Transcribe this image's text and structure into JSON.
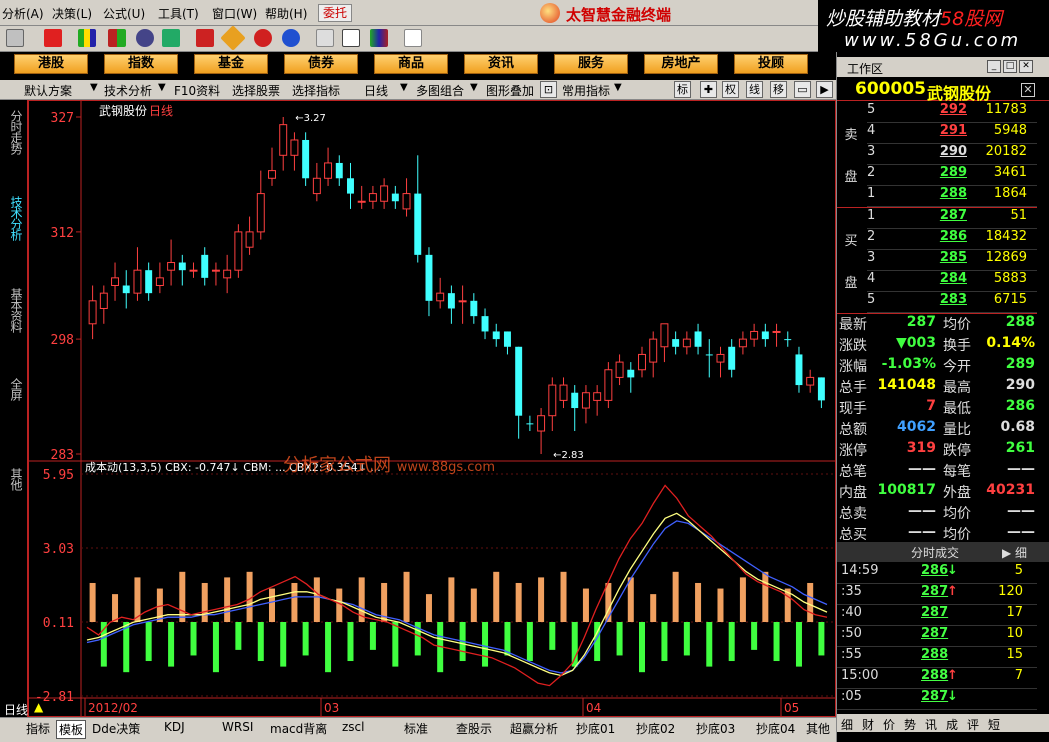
{
  "menu": [
    "分析(A)",
    "决策(L)",
    "公式(U)",
    "工具(T)",
    "窗口(W)",
    "帮助(H)"
  ],
  "weituo": "委托",
  "brand": "太智慧金融终端",
  "watermark": {
    "line1a": "炒股辅助教材",
    "line1b": "58股网",
    "line2": "www.58Gu.com"
  },
  "categories": [
    "港股",
    "指数",
    "基金",
    "债券",
    "商品",
    "资讯",
    "服务",
    "房地产",
    "投顾"
  ],
  "functions": [
    "默认方案",
    "技术分析",
    "F10资料",
    "选择股票",
    "选择指标",
    "日线",
    "多图组合",
    "图形叠加",
    "常用指标",
    "标",
    "权",
    "线",
    "移"
  ],
  "sidetabs": [
    "分时走势",
    "技术分析",
    "基本资料",
    "全屏",
    "其他"
  ],
  "chart": {
    "stock_name": "武钢股份",
    "period": "日线",
    "price_ticks": [
      "327",
      "312",
      "298",
      "283"
    ],
    "ind_ticks": [
      "5.95",
      "3.03",
      "0.11",
      "-2.81"
    ],
    "date_labels": [
      "2012/02",
      "03",
      "04",
      "05"
    ],
    "max_label": "3.27",
    "min_label": "2.83",
    "indicator_legend": "成本动(13,3,5)  CBX: -0.747↓  CBM: ...  CBX2: 0.354↓  ...",
    "watermark_text": "分析家公式网",
    "watermark_url": "www.88gs.com"
  },
  "chart_data": {
    "type": "candlestick",
    "title": "武钢股份 日线",
    "ylim": [
      2.83,
      3.27
    ],
    "candles": [
      {
        "o": 3.0,
        "c": 3.03,
        "h": 3.05,
        "l": 2.98,
        "up": true
      },
      {
        "o": 3.02,
        "c": 3.04,
        "h": 3.05,
        "l": 3.0,
        "up": true
      },
      {
        "o": 3.05,
        "c": 3.06,
        "h": 3.08,
        "l": 3.03,
        "up": true
      },
      {
        "o": 3.05,
        "c": 3.04,
        "h": 3.07,
        "l": 3.02,
        "up": false
      },
      {
        "o": 3.04,
        "c": 3.07,
        "h": 3.1,
        "l": 3.03,
        "up": true
      },
      {
        "o": 3.07,
        "c": 3.04,
        "h": 3.08,
        "l": 3.03,
        "up": false
      },
      {
        "o": 3.05,
        "c": 3.06,
        "h": 3.08,
        "l": 3.04,
        "up": true
      },
      {
        "o": 3.07,
        "c": 3.08,
        "h": 3.11,
        "l": 3.05,
        "up": true
      },
      {
        "o": 3.08,
        "c": 3.07,
        "h": 3.09,
        "l": 3.05,
        "up": false
      },
      {
        "o": 3.07,
        "c": 3.07,
        "h": 3.08,
        "l": 3.06,
        "up": true
      },
      {
        "o": 3.09,
        "c": 3.06,
        "h": 3.1,
        "l": 3.05,
        "up": false
      },
      {
        "o": 3.07,
        "c": 3.07,
        "h": 3.08,
        "l": 3.05,
        "up": true
      },
      {
        "o": 3.06,
        "c": 3.07,
        "h": 3.09,
        "l": 3.04,
        "up": true
      },
      {
        "o": 3.07,
        "c": 3.12,
        "h": 3.13,
        "l": 3.06,
        "up": true
      },
      {
        "o": 3.1,
        "c": 3.12,
        "h": 3.14,
        "l": 3.09,
        "up": true
      },
      {
        "o": 3.12,
        "c": 3.17,
        "h": 3.2,
        "l": 3.11,
        "up": true
      },
      {
        "o": 3.19,
        "c": 3.2,
        "h": 3.23,
        "l": 3.18,
        "up": true
      },
      {
        "o": 3.22,
        "c": 3.26,
        "h": 3.27,
        "l": 3.2,
        "up": true
      },
      {
        "o": 3.22,
        "c": 3.24,
        "h": 3.25,
        "l": 3.2,
        "up": true
      },
      {
        "o": 3.24,
        "c": 3.19,
        "h": 3.25,
        "l": 3.18,
        "up": false
      },
      {
        "o": 3.17,
        "c": 3.19,
        "h": 3.21,
        "l": 3.16,
        "up": true
      },
      {
        "o": 3.19,
        "c": 3.21,
        "h": 3.23,
        "l": 3.18,
        "up": true
      },
      {
        "o": 3.21,
        "c": 3.19,
        "h": 3.22,
        "l": 3.18,
        "up": false
      },
      {
        "o": 3.19,
        "c": 3.17,
        "h": 3.21,
        "l": 3.15,
        "up": false
      },
      {
        "o": 3.16,
        "c": 3.16,
        "h": 3.18,
        "l": 3.15,
        "up": true
      },
      {
        "o": 3.16,
        "c": 3.17,
        "h": 3.18,
        "l": 3.15,
        "up": true
      },
      {
        "o": 3.16,
        "c": 3.18,
        "h": 3.19,
        "l": 3.15,
        "up": true
      },
      {
        "o": 3.17,
        "c": 3.16,
        "h": 3.18,
        "l": 3.15,
        "up": false
      },
      {
        "o": 3.15,
        "c": 3.17,
        "h": 3.19,
        "l": 3.14,
        "up": true
      },
      {
        "o": 3.17,
        "c": 3.09,
        "h": 3.22,
        "l": 3.08,
        "up": false
      },
      {
        "o": 3.09,
        "c": 3.03,
        "h": 3.1,
        "l": 3.01,
        "up": false
      },
      {
        "o": 3.03,
        "c": 3.04,
        "h": 3.06,
        "l": 3.02,
        "up": true
      },
      {
        "o": 3.04,
        "c": 3.02,
        "h": 3.05,
        "l": 3.0,
        "up": false
      },
      {
        "o": 3.03,
        "c": 3.03,
        "h": 3.05,
        "l": 3.0,
        "up": true
      },
      {
        "o": 3.03,
        "c": 3.01,
        "h": 3.04,
        "l": 3.0,
        "up": false
      },
      {
        "o": 3.01,
        "c": 2.99,
        "h": 3.02,
        "l": 2.98,
        "up": false
      },
      {
        "o": 2.99,
        "c": 2.98,
        "h": 3.0,
        "l": 2.97,
        "up": false
      },
      {
        "o": 2.99,
        "c": 2.97,
        "h": 2.99,
        "l": 2.96,
        "up": false
      },
      {
        "o": 2.97,
        "c": 2.88,
        "h": 2.97,
        "l": 2.85,
        "up": false
      },
      {
        "o": 2.87,
        "c": 2.87,
        "h": 2.88,
        "l": 2.86,
        "up": false
      },
      {
        "o": 2.86,
        "c": 2.88,
        "h": 2.89,
        "l": 2.83,
        "up": true
      },
      {
        "o": 2.88,
        "c": 2.92,
        "h": 2.93,
        "l": 2.86,
        "up": true
      },
      {
        "o": 2.9,
        "c": 2.92,
        "h": 2.93,
        "l": 2.89,
        "up": true
      },
      {
        "o": 2.91,
        "c": 2.89,
        "h": 2.92,
        "l": 2.86,
        "up": false
      },
      {
        "o": 2.89,
        "c": 2.91,
        "h": 2.92,
        "l": 2.87,
        "up": true
      },
      {
        "o": 2.9,
        "c": 2.91,
        "h": 2.92,
        "l": 2.88,
        "up": true
      },
      {
        "o": 2.9,
        "c": 2.94,
        "h": 2.95,
        "l": 2.89,
        "up": true
      },
      {
        "o": 2.93,
        "c": 2.95,
        "h": 2.96,
        "l": 2.92,
        "up": true
      },
      {
        "o": 2.94,
        "c": 2.93,
        "h": 2.95,
        "l": 2.91,
        "up": false
      },
      {
        "o": 2.94,
        "c": 2.96,
        "h": 2.97,
        "l": 2.93,
        "up": true
      },
      {
        "o": 2.95,
        "c": 2.98,
        "h": 2.99,
        "l": 2.93,
        "up": true
      },
      {
        "o": 2.97,
        "c": 3.0,
        "h": 3.0,
        "l": 2.95,
        "up": true
      },
      {
        "o": 2.98,
        "c": 2.97,
        "h": 2.99,
        "l": 2.96,
        "up": false
      },
      {
        "o": 2.97,
        "c": 2.98,
        "h": 2.99,
        "l": 2.96,
        "up": true
      },
      {
        "o": 2.99,
        "c": 2.97,
        "h": 3.0,
        "l": 2.96,
        "up": false
      },
      {
        "o": 2.96,
        "c": 2.96,
        "h": 2.98,
        "l": 2.93,
        "up": false
      },
      {
        "o": 2.95,
        "c": 2.96,
        "h": 2.97,
        "l": 2.93,
        "up": true
      },
      {
        "o": 2.97,
        "c": 2.94,
        "h": 2.98,
        "l": 2.93,
        "up": false
      },
      {
        "o": 2.97,
        "c": 2.98,
        "h": 2.99,
        "l": 2.96,
        "up": true
      },
      {
        "o": 2.98,
        "c": 2.99,
        "h": 3.0,
        "l": 2.97,
        "up": true
      },
      {
        "o": 2.99,
        "c": 2.98,
        "h": 3.0,
        "l": 2.97,
        "up": false
      },
      {
        "o": 2.99,
        "c": 2.99,
        "h": 3.0,
        "l": 2.97,
        "up": true
      },
      {
        "o": 2.98,
        "c": 2.98,
        "h": 2.99,
        "l": 2.97,
        "up": false
      },
      {
        "o": 2.96,
        "c": 2.92,
        "h": 2.97,
        "l": 2.91,
        "up": false
      },
      {
        "o": 2.93,
        "c": 2.92,
        "h": 2.94,
        "l": 2.91,
        "up": true
      },
      {
        "o": 2.93,
        "c": 2.9,
        "h": 2.93,
        "l": 2.89,
        "up": false
      }
    ],
    "indicator": {
      "ylim": [
        -2.81,
        5.95
      ],
      "bars": [
        0.7,
        -0.8,
        0.5,
        -0.9,
        0.8,
        -0.7,
        0.6,
        -0.8,
        0.9,
        -0.6,
        0.7,
        -0.9,
        0.8,
        -0.5,
        0.9,
        -0.7,
        0.6,
        -0.8,
        0.7,
        -0.6,
        0.8,
        -0.9,
        0.6,
        -0.7,
        0.8,
        -0.5,
        0.7,
        -0.8,
        0.9,
        -0.6,
        0.5,
        -0.9,
        0.8,
        -0.7,
        0.6,
        -0.8,
        0.9,
        -0.6,
        0.7,
        -0.7,
        0.8,
        -0.5,
        0.9,
        -0.8,
        0.6,
        -0.7,
        0.7,
        -0.6,
        0.8,
        -0.9,
        0.5,
        -0.7,
        0.9,
        -0.6,
        0.7,
        -0.8,
        0.6,
        -0.7,
        0.8,
        -0.5,
        0.9,
        -0.7,
        0.6,
        -0.8,
        0.7,
        -0.6
      ],
      "red": [
        -0.1,
        -0.4,
        0.1,
        0.3,
        0.2,
        0.5,
        0.7,
        0.8,
        0.6,
        0.4,
        0.5,
        0.6,
        0.7,
        0.8,
        1.0,
        1.3,
        1.5,
        1.7,
        1.9,
        1.6,
        1.2,
        1.0,
        0.8,
        0.5,
        0.3,
        0.2,
        0.1,
        -0.1,
        -0.3,
        -0.5,
        -0.8,
        -0.9,
        -1.0,
        -1.1,
        -1.2,
        -1.3,
        -1.5,
        -1.7,
        -2.0,
        -2.3,
        -2.4,
        -2.0,
        -1.5,
        -0.5,
        0.6,
        1.6,
        2.6,
        3.4,
        4.0,
        4.8,
        5.5,
        5.0,
        4.3,
        3.9,
        3.5,
        3.0,
        2.5,
        2.0,
        1.7,
        1.5,
        1.3,
        1.0,
        0.6,
        0.4,
        0.3
      ],
      "yellow": [
        -0.6,
        -0.5,
        -0.3,
        -0.1,
        0.1,
        0.2,
        0.3,
        0.4,
        0.4,
        0.4,
        0.4,
        0.5,
        0.6,
        0.7,
        0.8,
        1.0,
        1.1,
        1.2,
        1.3,
        1.3,
        1.2,
        1.0,
        0.9,
        0.7,
        0.5,
        0.3,
        0.2,
        0.1,
        -0.1,
        -0.3,
        -0.5,
        -0.6,
        -0.7,
        -0.8,
        -0.9,
        -1.0,
        -1.1,
        -1.3,
        -1.5,
        -1.7,
        -1.9,
        -2.0,
        -1.8,
        -1.2,
        -0.4,
        0.5,
        1.4,
        2.2,
        2.9,
        3.6,
        4.2,
        4.4,
        4.1,
        3.7,
        3.3,
        2.9,
        2.5,
        2.1,
        1.8,
        1.6,
        1.4,
        1.2,
        0.9,
        0.7,
        0.5
      ],
      "blue": [
        -0.7,
        -0.6,
        -0.4,
        -0.2,
        0.0,
        0.1,
        0.2,
        0.3,
        0.3,
        0.3,
        0.4,
        0.4,
        0.5,
        0.6,
        0.7,
        0.8,
        0.9,
        1.0,
        1.1,
        1.1,
        1.1,
        1.0,
        0.9,
        0.8,
        0.6,
        0.4,
        0.3,
        0.2,
        0.0,
        -0.2,
        -0.4,
        -0.5,
        -0.6,
        -0.7,
        -0.8,
        -0.9,
        -1.0,
        -1.2,
        -1.4,
        -1.6,
        -1.8,
        -1.9,
        -1.8,
        -1.3,
        -0.6,
        0.2,
        1.0,
        1.8,
        2.5,
        3.2,
        3.8,
        4.1,
        4.0,
        3.7,
        3.4,
        3.1,
        2.8,
        2.5,
        2.2,
        1.9,
        1.7,
        1.5,
        1.2,
        1.0,
        0.8
      ]
    }
  },
  "quote": {
    "code": "600005",
    "name": "武钢股份",
    "sell_label": [
      "卖",
      "盘"
    ],
    "buy_label": [
      "买",
      "盘"
    ],
    "asks": [
      {
        "level": "5",
        "price": "292",
        "vol": "11783",
        "color": "#ff4040"
      },
      {
        "level": "4",
        "price": "291",
        "vol": "5948",
        "color": "#ff4040"
      },
      {
        "level": "3",
        "price": "290",
        "vol": "20182",
        "color": "#dddddd"
      },
      {
        "level": "2",
        "price": "289",
        "vol": "3461",
        "color": "#40ff40"
      },
      {
        "level": "1",
        "price": "288",
        "vol": "1864",
        "color": "#40ff40"
      }
    ],
    "bids": [
      {
        "level": "1",
        "price": "287",
        "vol": "51",
        "color": "#40ff40"
      },
      {
        "level": "2",
        "price": "286",
        "vol": "18432",
        "color": "#40ff40"
      },
      {
        "level": "3",
        "price": "285",
        "vol": "12869",
        "color": "#40ff40"
      },
      {
        "level": "4",
        "price": "284",
        "vol": "5883",
        "color": "#40ff40"
      },
      {
        "level": "5",
        "price": "283",
        "vol": "6715",
        "color": "#40ff40"
      }
    ],
    "stats": [
      {
        "k": "最新",
        "v": "287",
        "vc": "#40ff40",
        "k2": "均价",
        "v2": "288",
        "v2c": "#40ff40"
      },
      {
        "k": "涨跌",
        "v": "▼003",
        "vc": "#40ff40",
        "k2": "换手",
        "v2": "0.14%",
        "v2c": "#ffff00"
      },
      {
        "k": "涨幅",
        "v": "-1.03%",
        "vc": "#40ff40",
        "k2": "今开",
        "v2": "289",
        "v2c": "#40ff40"
      },
      {
        "k": "总手",
        "v": "141048",
        "vc": "#ffff00",
        "k2": "最高",
        "v2": "290",
        "v2c": "#dddddd"
      },
      {
        "k": "现手",
        "v": "7",
        "vc": "#ff4040",
        "k2": "最低",
        "v2": "286",
        "v2c": "#40ff40"
      },
      {
        "k": "总额",
        "v": "4062",
        "vc": "#40a0ff",
        "k2": "量比",
        "v2": "0.68",
        "v2c": "#dddddd"
      },
      {
        "k": "涨停",
        "v": "319",
        "vc": "#ff4040",
        "k2": "跌停",
        "v2": "261",
        "v2c": "#40ff40"
      },
      {
        "k": "总笔",
        "v": "——",
        "vc": "#dddddd",
        "k2": "每笔",
        "v2": "——",
        "v2c": "#dddddd"
      },
      {
        "k": "内盘",
        "v": "100817",
        "vc": "#40ff40",
        "k2": "外盘",
        "v2": "40231",
        "v2c": "#ff4040"
      },
      {
        "k": "总卖",
        "v": "——",
        "vc": "#dddddd",
        "k2": "均价",
        "v2": "——",
        "v2c": "#dddddd"
      },
      {
        "k": "总买",
        "v": "——",
        "vc": "#dddddd",
        "k2": "均价",
        "v2": "——",
        "v2c": "#dddddd"
      }
    ],
    "ticks_title": "分时成交",
    "ticks_more": "细",
    "ticks": [
      {
        "t": "14:59",
        "p": "286",
        "a": "↓",
        "ac": "#40ff40",
        "q": "5"
      },
      {
        "t": ":35",
        "p": "287",
        "a": "↑",
        "ac": "#ff4040",
        "q": "120"
      },
      {
        "t": ":40",
        "p": "287",
        "a": "",
        "ac": "#ff4040",
        "q": "17"
      },
      {
        "t": ":50",
        "p": "287",
        "a": "",
        "ac": "#ff4040",
        "q": "10"
      },
      {
        "t": ":55",
        "p": "288",
        "a": "",
        "ac": "#ff4040",
        "q": "15"
      },
      {
        "t": "15:00",
        "p": "288",
        "a": "↑",
        "ac": "#ff4040",
        "q": "7"
      },
      {
        "t": ":05",
        "p": "287",
        "a": "↓",
        "ac": "#40ff40",
        "q": ""
      }
    ],
    "rtabs": [
      "细",
      "财",
      "价",
      "势",
      "讯",
      "成",
      "评",
      "短"
    ]
  },
  "workarea": "工作区",
  "bottomtabs": [
    "指标",
    "模板",
    "Dde决策",
    "KDJ",
    "WRSI",
    "macd背离",
    "zscl",
    "标准",
    "查股示",
    "超赢分析",
    "抄底01",
    "抄底02",
    "抄底03",
    "抄底04",
    "其他"
  ],
  "day_label": "日线"
}
